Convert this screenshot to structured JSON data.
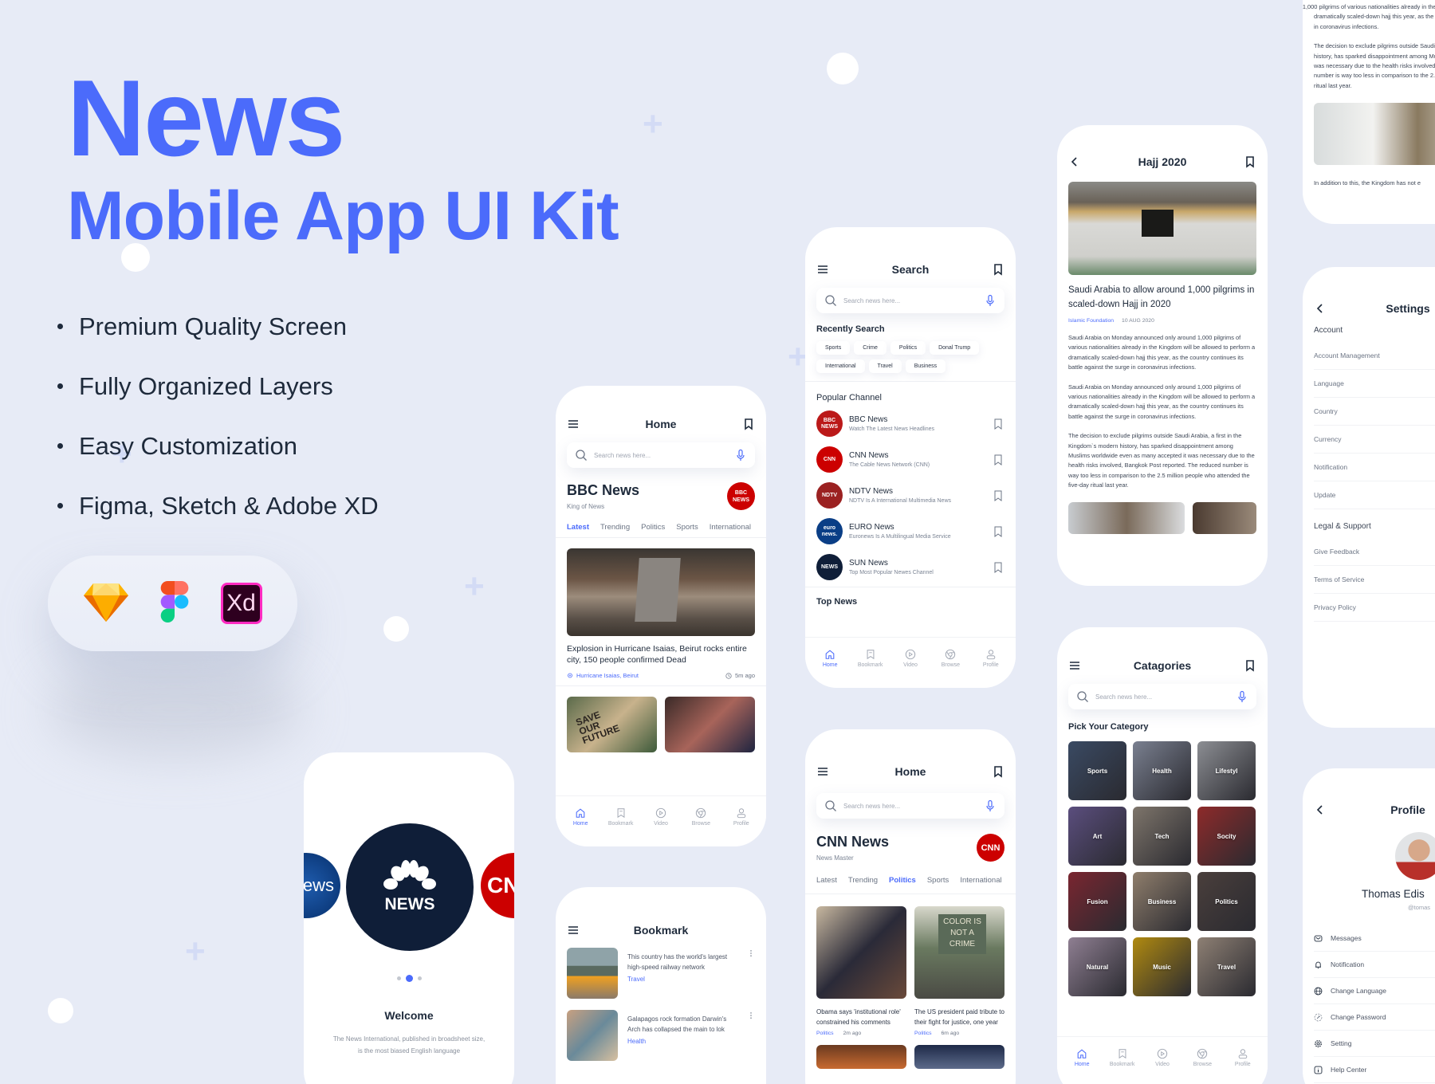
{
  "colors": {
    "accent": "#4B6BFB",
    "text": "#1E2A3B",
    "muted": "#7B8494",
    "background": "#E7EBF6"
  },
  "hero": {
    "title": "News",
    "subtitle": "Mobile App UI Kit",
    "features": [
      "Premium Quality Screen",
      "Fully Organized Layers",
      "Easy Customization",
      "Figma, Sketch & Adobe XD"
    ],
    "tools": [
      {
        "icon": "sketch-icon"
      },
      {
        "icon": "figma-icon"
      },
      {
        "icon": "adobe-xd-icon",
        "label": "Xd"
      }
    ]
  },
  "nav": [
    {
      "label": "Home",
      "icon": "home-icon"
    },
    {
      "label": "Bookmark",
      "icon": "bookmark-icon"
    },
    {
      "label": "Video",
      "icon": "play-icon"
    },
    {
      "label": "Browse",
      "icon": "browse-icon"
    },
    {
      "label": "Profile",
      "icon": "user-icon"
    }
  ],
  "search_placeholder": "Search news here...",
  "welcome": {
    "logos": [
      "euronews",
      "NEWS",
      "CNN"
    ],
    "title": "Welcome",
    "text": "The News International, published in broadsheet size, is the most biased English language",
    "page": 2,
    "pages": 3
  },
  "home_bbc": {
    "title": "Home",
    "channel": "BBC News",
    "tagline": "King of News",
    "logo": "BBC NEWS",
    "tabs": [
      "Latest",
      "Trending",
      "Politics",
      "Sports",
      "International"
    ],
    "active_tab": "Latest",
    "featured": {
      "headline": "Explosion in Hurricane Isaias, Beirut rocks entire city, 150 people confirmed Dead",
      "location": "Hurricane Isaias, Beirut",
      "time": "5m ago"
    },
    "thumbs": [
      "SAVE OUR FUTURE",
      ""
    ]
  },
  "bookmark": {
    "title": "Bookmark",
    "items": [
      {
        "title": "This country has the world's largest high-speed railway network",
        "category": "Travel"
      },
      {
        "title": "Galapagos rock formation Darwin's Arch has collapsed the main to lok",
        "category": "Health"
      }
    ]
  },
  "search_screen": {
    "title": "Search",
    "recent_title": "Recently Search",
    "chips": [
      "Sports",
      "Crime",
      "Politics",
      "Donal Trump",
      "International",
      "Travel",
      "Business"
    ],
    "popular_title": "Popular Channel",
    "channels": [
      {
        "name": "BBC News",
        "desc": "Watch The Latest News Headlines",
        "logo": "BBC NEWS",
        "color": "#BB1919"
      },
      {
        "name": "CNN News",
        "desc": "The Cable News Network (CNN)",
        "logo": "CNN",
        "color": "#CC0000"
      },
      {
        "name": "NDTV News",
        "desc": "NDTV Is A International Multimedia News",
        "logo": "NDTV",
        "color": "#9B2121"
      },
      {
        "name": "EURO News",
        "desc": "Euronews Is A Multilingual Media Service",
        "logo": "euro news.",
        "color": "#0A3E86"
      },
      {
        "name": "SUN News",
        "desc": "Top Most Popular Newes Channel",
        "logo": "NEWS",
        "color": "#0F1E38"
      }
    ],
    "top_title": "Top News"
  },
  "home_cnn": {
    "title": "Home",
    "channel": "CNN News",
    "tagline": "News Master",
    "logo": "CNN",
    "tabs": [
      "Latest",
      "Trending",
      "Politics",
      "Sports",
      "International"
    ],
    "active_tab": "Politics",
    "cards": [
      {
        "title": "Obama says 'institutional role' constrained his comments",
        "category": "Politics",
        "time": "2m ago"
      },
      {
        "title": "The US president paid tribute to their fight for justice, one year",
        "category": "Politics",
        "time": "6m ago",
        "image_text": "COLOR IS NOT A CRIME"
      }
    ]
  },
  "hajj": {
    "title": "Hajj 2020",
    "headline": "Saudi Arabia to allow around 1,000 pilgrims in scaled-down Hajj in 2020",
    "source": "Islamic Foundation",
    "date": "10 AUG 2020",
    "paragraphs": [
      "Saudi Arabia on Monday announced only around 1,000 pilgrims of various nationalities already in the Kingdom will be allowed to perform a dramatically scaled-down hajj this year, as the country continues its battle against the surge in coronavirus infections.",
      "Saudi Arabia on Monday announced only around 1,000 pilgrims of various nationalities already in the Kingdom will be allowed to perform a dramatically scaled-down hajj this year, as the country continues its battle against the surge in coronavirus infections.",
      "The decision to exclude pilgrims outside Saudi Arabia, a first in the Kingdom`s modern history, has sparked disappointment among Muslims worldwide even as many accepted it was necessary due to the health risks involved, Bangkok Post reported. The reduced number is way too less in comparison to the 2.5 million people who attended the five-day ritual last year."
    ],
    "continued": "In addition to this, the Kingdom has not e"
  },
  "categories": {
    "title": "Catagories",
    "pick_title": "Pick Your Category",
    "items": [
      {
        "label": "Sports",
        "color": "#3A4A63"
      },
      {
        "label": "Health",
        "color": "#7A8090"
      },
      {
        "label": "Lifestyl",
        "color": "#8C8E93"
      },
      {
        "label": "Art",
        "color": "#5B4E7E"
      },
      {
        "label": "Tech",
        "color": "#7E756B"
      },
      {
        "label": "Socity",
        "color": "#8E2A2A"
      },
      {
        "label": "Fusion",
        "color": "#7A2630"
      },
      {
        "label": "Business",
        "color": "#8F7E6C"
      },
      {
        "label": "Politics",
        "color": "#4A3F3C"
      },
      {
        "label": "Natural",
        "color": "#8F7F92"
      },
      {
        "label": "Music",
        "color": "#B08A10"
      },
      {
        "label": "Travel",
        "color": "#8E8074"
      }
    ]
  },
  "settings": {
    "title": "Settings",
    "sections": [
      {
        "title": "Account",
        "items": [
          "Account Management",
          "Language",
          "Country",
          "Currency",
          "Notification",
          "Update"
        ]
      },
      {
        "title": "Legal & Support",
        "items": [
          "Give Feedback",
          "Terms of Service",
          "Privacy Policy"
        ]
      }
    ]
  },
  "profile": {
    "title": "Profile",
    "name": "Thomas Edis",
    "handle": "@tomas",
    "items": [
      {
        "label": "Messages",
        "icon": "message-icon"
      },
      {
        "label": "Notification",
        "icon": "bell-icon"
      },
      {
        "label": "Change Language",
        "icon": "globe-icon"
      },
      {
        "label": "Change Password",
        "icon": "key-icon"
      },
      {
        "label": "Setting",
        "icon": "gear-icon"
      },
      {
        "label": "Help Center",
        "icon": "info-icon"
      }
    ]
  }
}
